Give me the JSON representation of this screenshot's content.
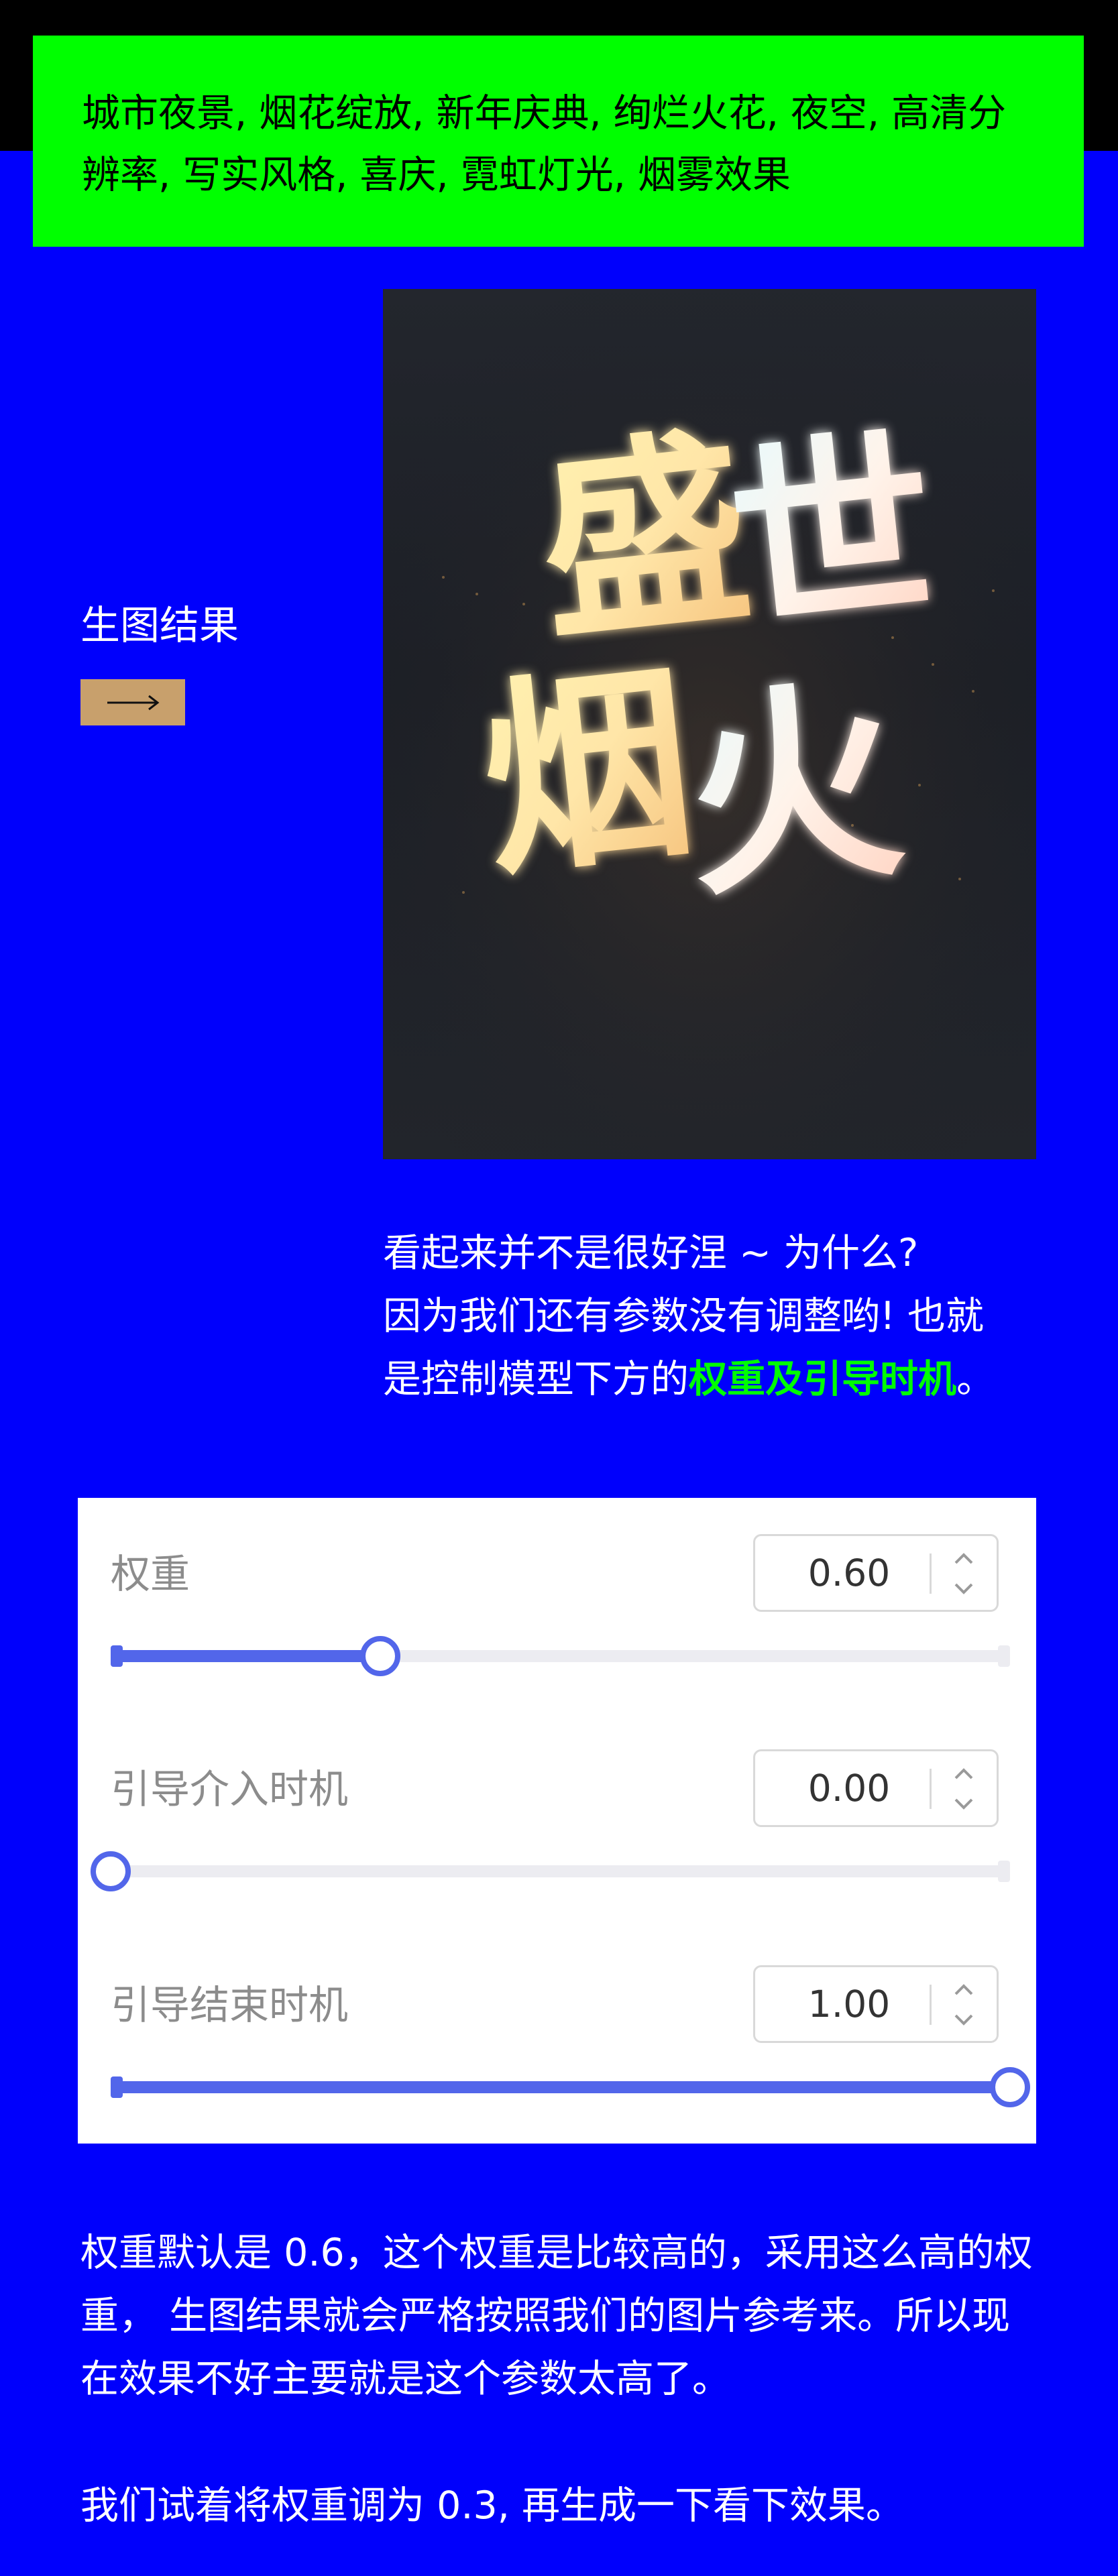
{
  "prompt": {
    "line1": "城市夜景, 烟花绽放, 新年庆典, 绚烂火花, 夜空, 高清分",
    "line2": "辨率, 写实风格, 喜庆, 霓虹灯光, 烟雾效果"
  },
  "result": {
    "label": "生图结果",
    "arrow_icon": "long-right-arrow-icon",
    "poster_text": [
      "盛",
      "世",
      "烟",
      "火"
    ]
  },
  "explain": {
    "line1": "看起来并不是很好涅 ~ 为什么?",
    "line2": "因为我们还有参数没有调整哟! 也就",
    "line3_prefix": "是控制模型下方的",
    "line3_highlight": "权重及引导时机",
    "line3_suffix": "。"
  },
  "controls": {
    "accent_color": "#5266ea",
    "params": [
      {
        "label": "权重",
        "value_text": "0.60",
        "value": 0.6,
        "fill_fraction": 0.3
      },
      {
        "label": "引导介入时机",
        "value_text": "0.00",
        "value": 0.0,
        "fill_fraction": 0.0
      },
      {
        "label": "引导结束时机",
        "value_text": "1.00",
        "value": 1.0,
        "fill_fraction": 1.0
      }
    ]
  },
  "notes": {
    "line1": "权重默认是 0.6，这个权重是比较高的，采用这么高的权",
    "line2": "重， 生图结果就会严格按照我们的图片参考来。所以现",
    "line3": "在效果不好主要就是这个参数太高了。",
    "line4": "我们试着将权重调为 0.3, 再生成一下看下效果。"
  },
  "colors": {
    "background": "#0000fc",
    "prompt_background": "#00ff00",
    "highlight": "#00ff00",
    "button": "#c8a06c"
  }
}
